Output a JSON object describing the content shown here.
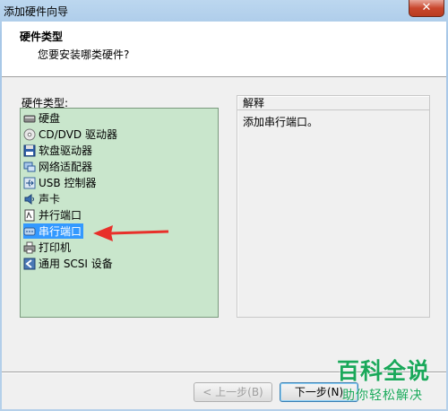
{
  "window": {
    "title": "添加硬件向导",
    "close_glyph": "✕"
  },
  "header": {
    "title": "硬件类型",
    "subtitle": "您要安装哪类硬件?"
  },
  "list": {
    "label": "硬件类型:",
    "items": [
      {
        "label": "硬盘",
        "icon": "hard-disk-icon"
      },
      {
        "label": "CD/DVD 驱动器",
        "icon": "cd-dvd-icon"
      },
      {
        "label": "软盘驱动器",
        "icon": "floppy-icon"
      },
      {
        "label": "网络适配器",
        "icon": "network-adapter-icon"
      },
      {
        "label": "USB 控制器",
        "icon": "usb-icon"
      },
      {
        "label": "声卡",
        "icon": "sound-card-icon"
      },
      {
        "label": "并行端口",
        "icon": "parallel-port-icon"
      },
      {
        "label": "串行端口",
        "icon": "serial-port-icon",
        "selected": true
      },
      {
        "label": "打印机",
        "icon": "printer-icon"
      },
      {
        "label": "通用 SCSI 设备",
        "icon": "scsi-icon"
      }
    ]
  },
  "explanation": {
    "label": "解释",
    "text": "添加串行端口。"
  },
  "buttons": {
    "back": "< 上一步(B)",
    "next": "下一步(N)"
  },
  "watermark": {
    "brand": "百科全说",
    "slogan": "助你轻松解决"
  },
  "colors": {
    "listbox_bg": "#c9e6cc",
    "selection": "#3399ff",
    "arrow": "#e8302a",
    "watermark": "#1aa85a"
  }
}
